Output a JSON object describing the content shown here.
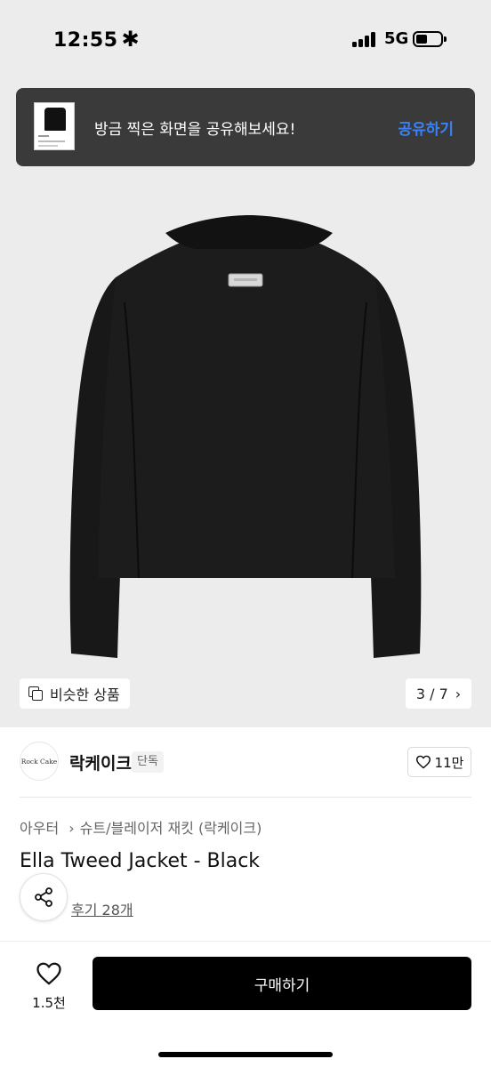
{
  "status_bar": {
    "time": "12:55",
    "network": "5G"
  },
  "toast": {
    "message": "방금 찍은 화면을 공유해보세요!",
    "action": "공유하기"
  },
  "gallery": {
    "similar_label": "비슷한 상품",
    "page_indicator": "3 / 7",
    "current_image": 3,
    "total_images": 7
  },
  "seller": {
    "logo_text": "Rock Cake",
    "name": "락케이크",
    "tag": "단독",
    "likes": "11만"
  },
  "product": {
    "breadcrumb": [
      "아우터",
      "슈트/블레이저 재킷 (락케이크)"
    ],
    "title": "Ella Tweed Jacket - Black",
    "review_label": "후기 28개"
  },
  "bottom_bar": {
    "wish_count": "1.5천",
    "buy_label": "구매하기"
  },
  "colors": {
    "accent": "#3b82f6",
    "toast_bg": "#3a3a3a",
    "buy_bg": "#000000",
    "hero_bg": "#ececec"
  }
}
